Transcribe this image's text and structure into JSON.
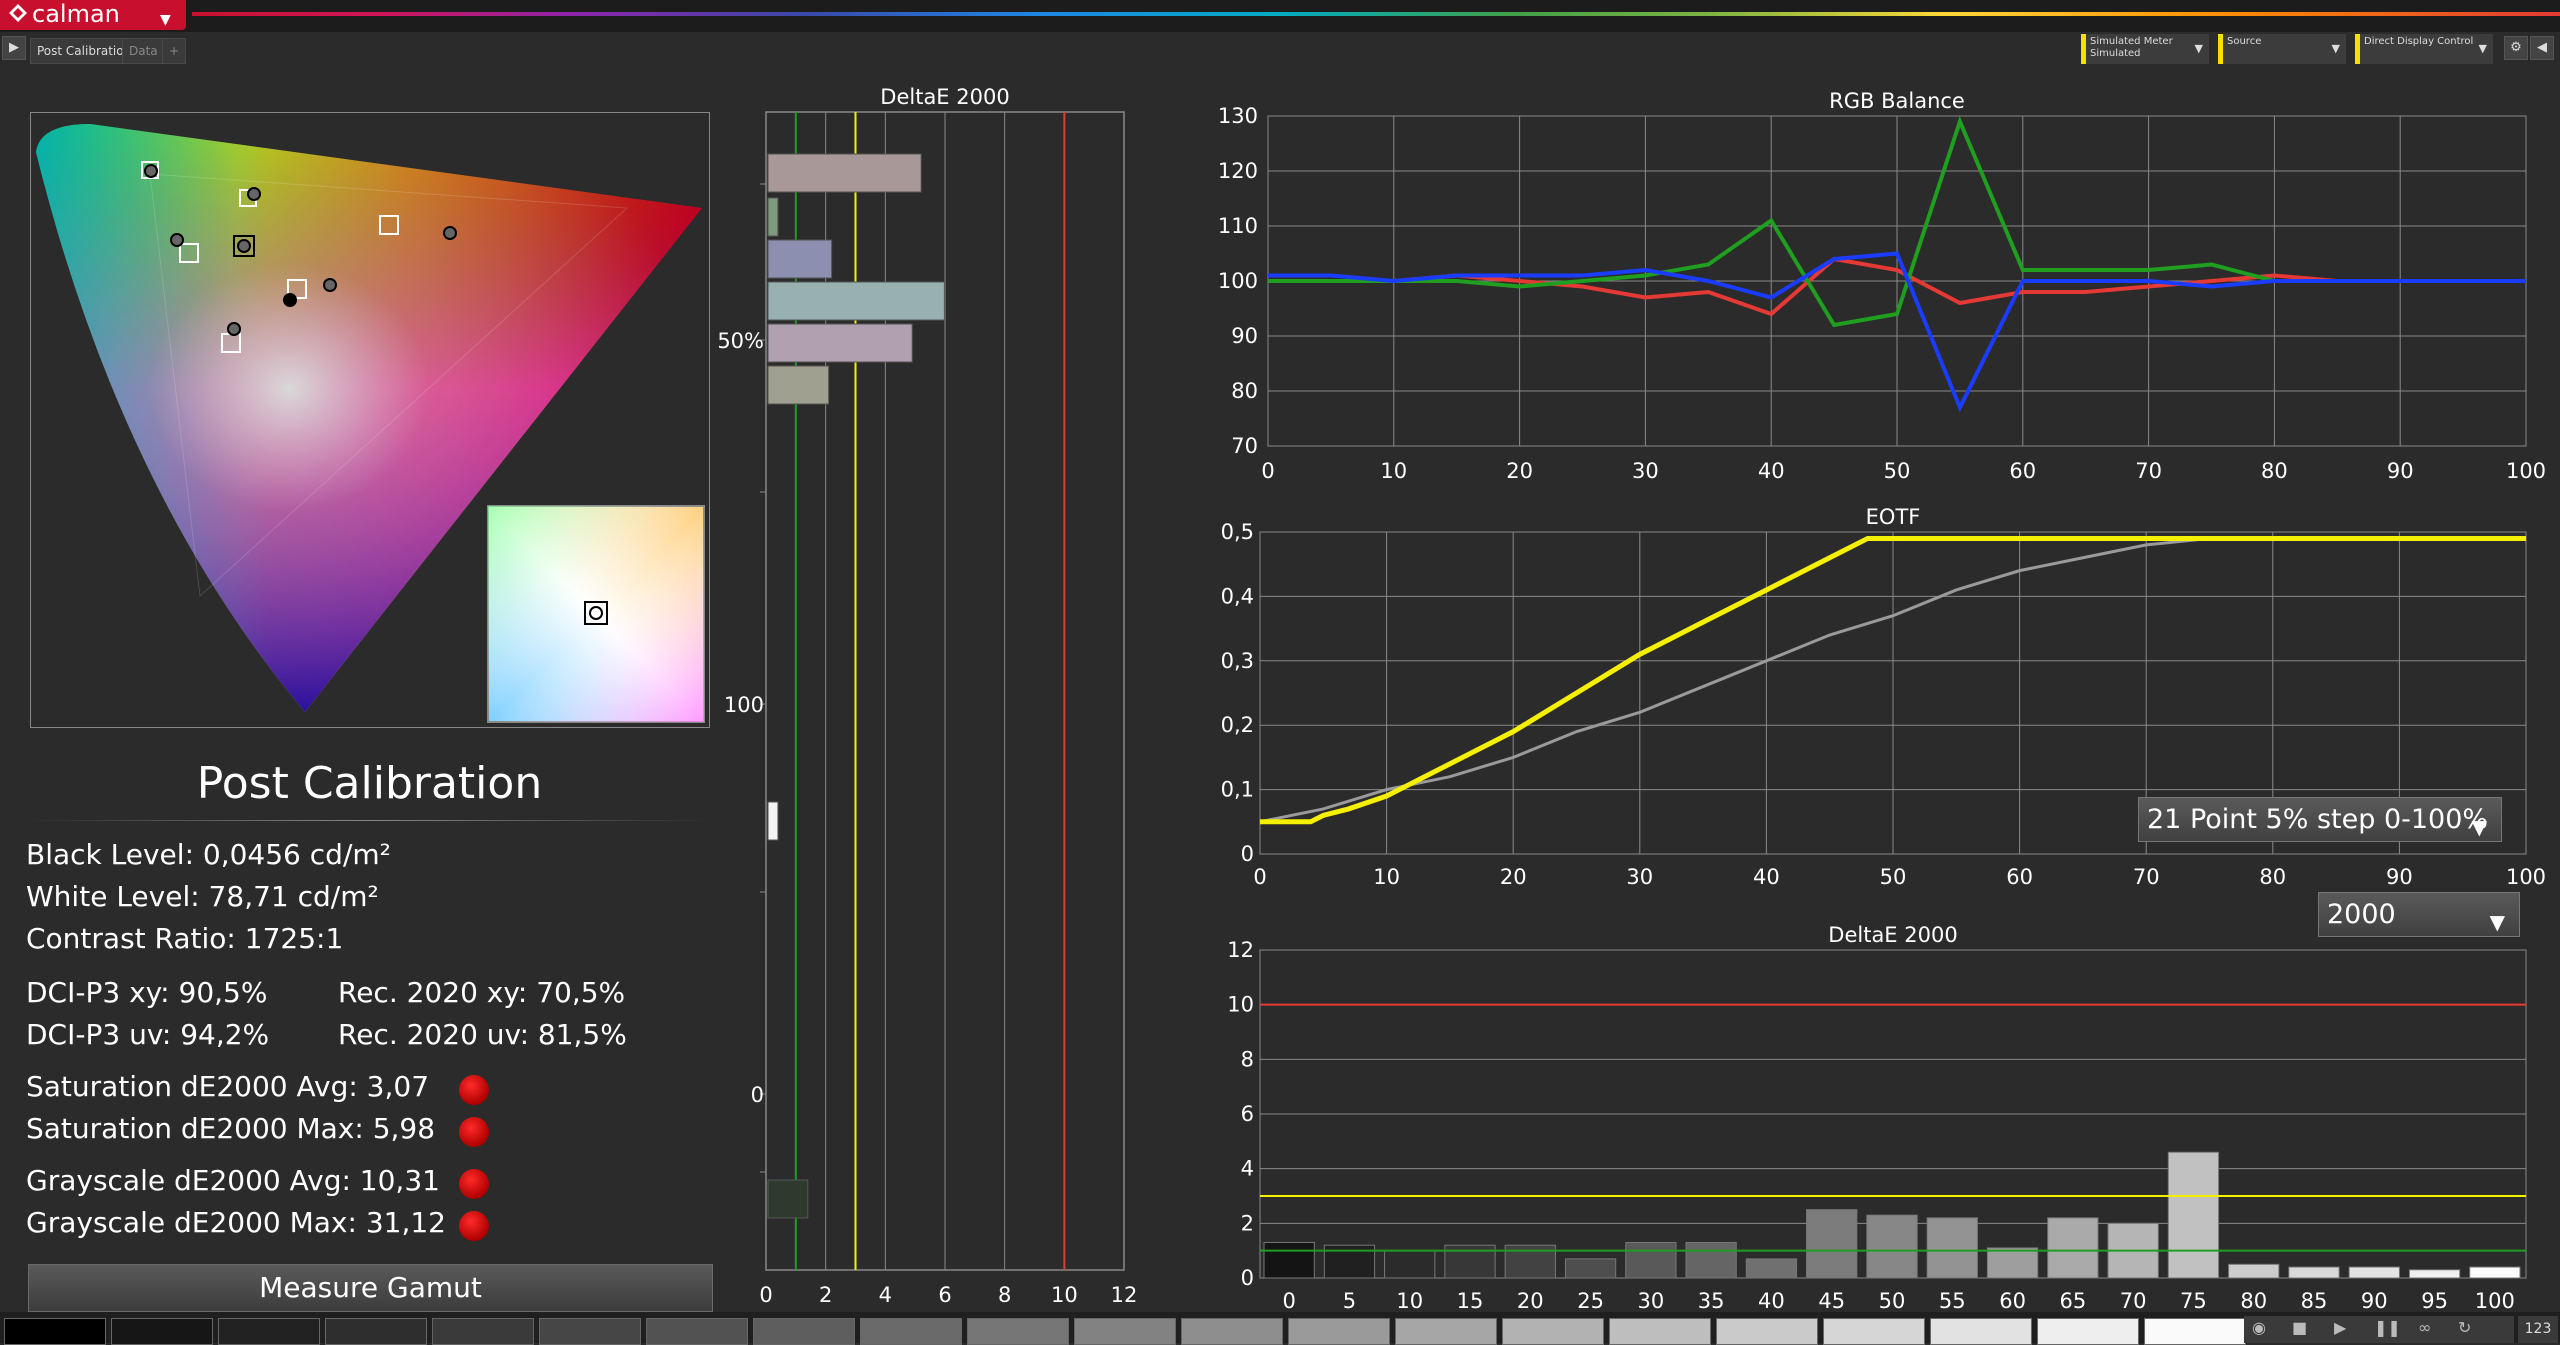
{
  "app": {
    "name": "calman"
  },
  "tabs": [
    {
      "label": "Post Calibration"
    },
    {
      "label": "Data"
    },
    {
      "label": "+"
    }
  ],
  "header_controls": [
    {
      "label": "Simulated Meter",
      "sub": "Simulated"
    },
    {
      "label": "Source",
      "sub": ""
    },
    {
      "label": "Direct Display Control",
      "sub": ""
    }
  ],
  "icons": {
    "play": "play-icon",
    "settings": "gear-icon",
    "back": "back-icon",
    "dropdown": "chevron-down-icon",
    "record": "record-icon"
  },
  "accent_colors": {
    "brand": "#c8102e",
    "target_line": "#f5e100",
    "limit_line": "#e53935",
    "green_line": "#2e9e2e"
  },
  "post_calibration": {
    "title": "Post Calibration",
    "black_level": "Black Level: 0,0456 cd/m²",
    "white_level": "White Level: 78,71 cd/m²",
    "contrast_ratio": "Contrast Ratio: 1725:1",
    "dci_p3_xy": "DCI-P3 xy: 90,5%",
    "rec2020_xy": "Rec. 2020 xy: 70,5%",
    "dci_p3_uv": "DCI-P3 uv: 94,2%",
    "rec2020_uv": "Rec. 2020 uv: 81,5%",
    "sat_avg": "Saturation dE2000 Avg: 3,07",
    "sat_max": "Saturation dE2000 Max: 5,98",
    "gray_avg": "Grayscale dE2000 Avg: 10,31",
    "gray_max": "Grayscale dE2000 Max: 31,12",
    "measure_button": "Measure Gamut"
  },
  "eotf_select": "21 Point 5% step 0-100%",
  "de_select": "2000",
  "chart_data": [
    {
      "type": "bar",
      "title": "DeltaE 2000",
      "orientation": "horizontal",
      "x_ticks": [
        "0",
        "2",
        "4",
        "6",
        "8",
        "10",
        "12"
      ],
      "xlim": [
        0,
        12
      ],
      "y_tick_labels": [
        "50%",
        "100",
        "0"
      ],
      "reference_lines": [
        {
          "value": 1,
          "color": "green"
        },
        {
          "value": 3,
          "color": "yellow"
        },
        {
          "value": 10,
          "color": "red"
        }
      ],
      "bars": [
        {
          "value": 5.2,
          "color": "#a89898"
        },
        {
          "value": 0.4,
          "color": "#7f9a7f"
        },
        {
          "value": 2.2,
          "color": "#8c8fb0"
        },
        {
          "value": 5.98,
          "color": "#98b0b0"
        },
        {
          "value": 4.9,
          "color": "#b0a0b0"
        },
        {
          "value": 2.1,
          "color": "#a0a090"
        },
        {
          "value": 0.4,
          "color": "#f2f2f2"
        },
        {
          "value": 1.4,
          "color": "#2e3a2e"
        }
      ]
    },
    {
      "type": "line",
      "title": "RGB Balance",
      "x": [
        0,
        5,
        10,
        15,
        20,
        25,
        30,
        35,
        40,
        45,
        50,
        55,
        60,
        65,
        70,
        75,
        80,
        85,
        90,
        95,
        100
      ],
      "xlim": [
        0,
        100
      ],
      "ylim": [
        70,
        130
      ],
      "x_ticks": [
        0,
        10,
        20,
        30,
        40,
        50,
        60,
        70,
        80,
        90,
        100
      ],
      "y_ticks": [
        70,
        80,
        90,
        100,
        110,
        120,
        130
      ],
      "series": [
        {
          "color": "red",
          "values": [
            100,
            100,
            100,
            101,
            100,
            99,
            97,
            98,
            94,
            104,
            102,
            96,
            98,
            98,
            99,
            100,
            101,
            100,
            100,
            100,
            100
          ]
        },
        {
          "color": "green",
          "values": [
            100,
            100,
            100,
            100,
            99,
            100,
            101,
            103,
            111,
            92,
            94,
            129,
            102,
            102,
            102,
            103,
            100,
            100,
            100,
            100,
            100
          ]
        },
        {
          "color": "blue",
          "values": [
            101,
            101,
            100,
            101,
            101,
            101,
            102,
            100,
            97,
            104,
            105,
            77,
            100,
            100,
            100,
            99,
            100,
            100,
            100,
            100,
            100
          ]
        }
      ]
    },
    {
      "type": "line",
      "title": "EOTF",
      "xlim": [
        0,
        100
      ],
      "ylim": [
        0,
        0.5
      ],
      "x_ticks": [
        0,
        10,
        20,
        30,
        40,
        50,
        60,
        70,
        80,
        90,
        100
      ],
      "y_ticks": [
        "0",
        "0,1",
        "0,2",
        "0,3",
        "0,4",
        "0,5"
      ],
      "series": [
        {
          "color": "yellow",
          "x": [
            0,
            4,
            5,
            7,
            10,
            15,
            20,
            25,
            30,
            35,
            40,
            45,
            48,
            50,
            55,
            60,
            65,
            70,
            75,
            80,
            85,
            90,
            95,
            100
          ],
          "values": [
            0.05,
            0.05,
            0.06,
            0.07,
            0.09,
            0.14,
            0.19,
            0.25,
            0.31,
            0.36,
            0.41,
            0.46,
            0.49,
            0.49,
            0.49,
            0.49,
            0.49,
            0.49,
            0.49,
            0.49,
            0.49,
            0.49,
            0.49,
            0.49
          ]
        },
        {
          "color": "gray",
          "x": [
            0,
            5,
            10,
            15,
            20,
            25,
            30,
            35,
            40,
            45,
            50,
            55,
            60,
            65,
            70,
            75,
            80,
            85,
            90,
            95,
            100
          ],
          "values": [
            0.05,
            0.07,
            0.1,
            0.12,
            0.15,
            0.19,
            0.22,
            0.26,
            0.3,
            0.34,
            0.37,
            0.41,
            0.44,
            0.46,
            0.48,
            0.49,
            0.49,
            0.49,
            0.49,
            0.49,
            0.49
          ]
        }
      ]
    },
    {
      "type": "bar",
      "title": "DeltaE 2000",
      "categories": [
        "0",
        "5",
        "10",
        "15",
        "20",
        "25",
        "30",
        "35",
        "40",
        "45",
        "50",
        "55",
        "60",
        "65",
        "70",
        "75",
        "80",
        "85",
        "90",
        "95",
        "100"
      ],
      "values": [
        1.3,
        1.2,
        1.0,
        1.2,
        1.2,
        0.7,
        1.3,
        1.3,
        0.7,
        2.5,
        2.3,
        2.2,
        1.1,
        2.2,
        2.0,
        4.6,
        0.5,
        0.4,
        0.4,
        0.3,
        0.4
      ],
      "ylim": [
        0,
        12
      ],
      "y_ticks": [
        0,
        2,
        4,
        6,
        8,
        10,
        12
      ],
      "reference_lines": [
        {
          "value": 1,
          "color": "green"
        },
        {
          "value": 3,
          "color": "yellow"
        },
        {
          "value": 10,
          "color": "red"
        }
      ]
    }
  ],
  "swatch_bar": {
    "page_indicator": "123"
  }
}
